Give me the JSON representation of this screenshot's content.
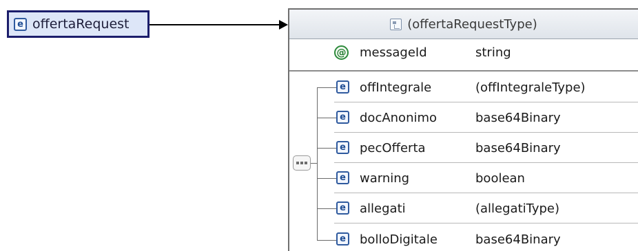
{
  "root_element": {
    "name": "offertaRequest",
    "kind": "e"
  },
  "type_header": {
    "label": "(offertaRequestType)"
  },
  "attributes": [
    {
      "kind": "@",
      "name": "messageId",
      "type": "string"
    }
  ],
  "elements": [
    {
      "kind": "e",
      "name": "offIntegrale",
      "type": "(offIntegraleType)"
    },
    {
      "kind": "e",
      "name": "docAnonimo",
      "type": "base64Binary"
    },
    {
      "kind": "e",
      "name": "pecOfferta",
      "type": "base64Binary"
    },
    {
      "kind": "e",
      "name": "warning",
      "type": "boolean"
    },
    {
      "kind": "e",
      "name": "allegati",
      "type": "(allegatiType)"
    },
    {
      "kind": "e",
      "name": "bolloDigitale",
      "type": "base64Binary"
    }
  ]
}
